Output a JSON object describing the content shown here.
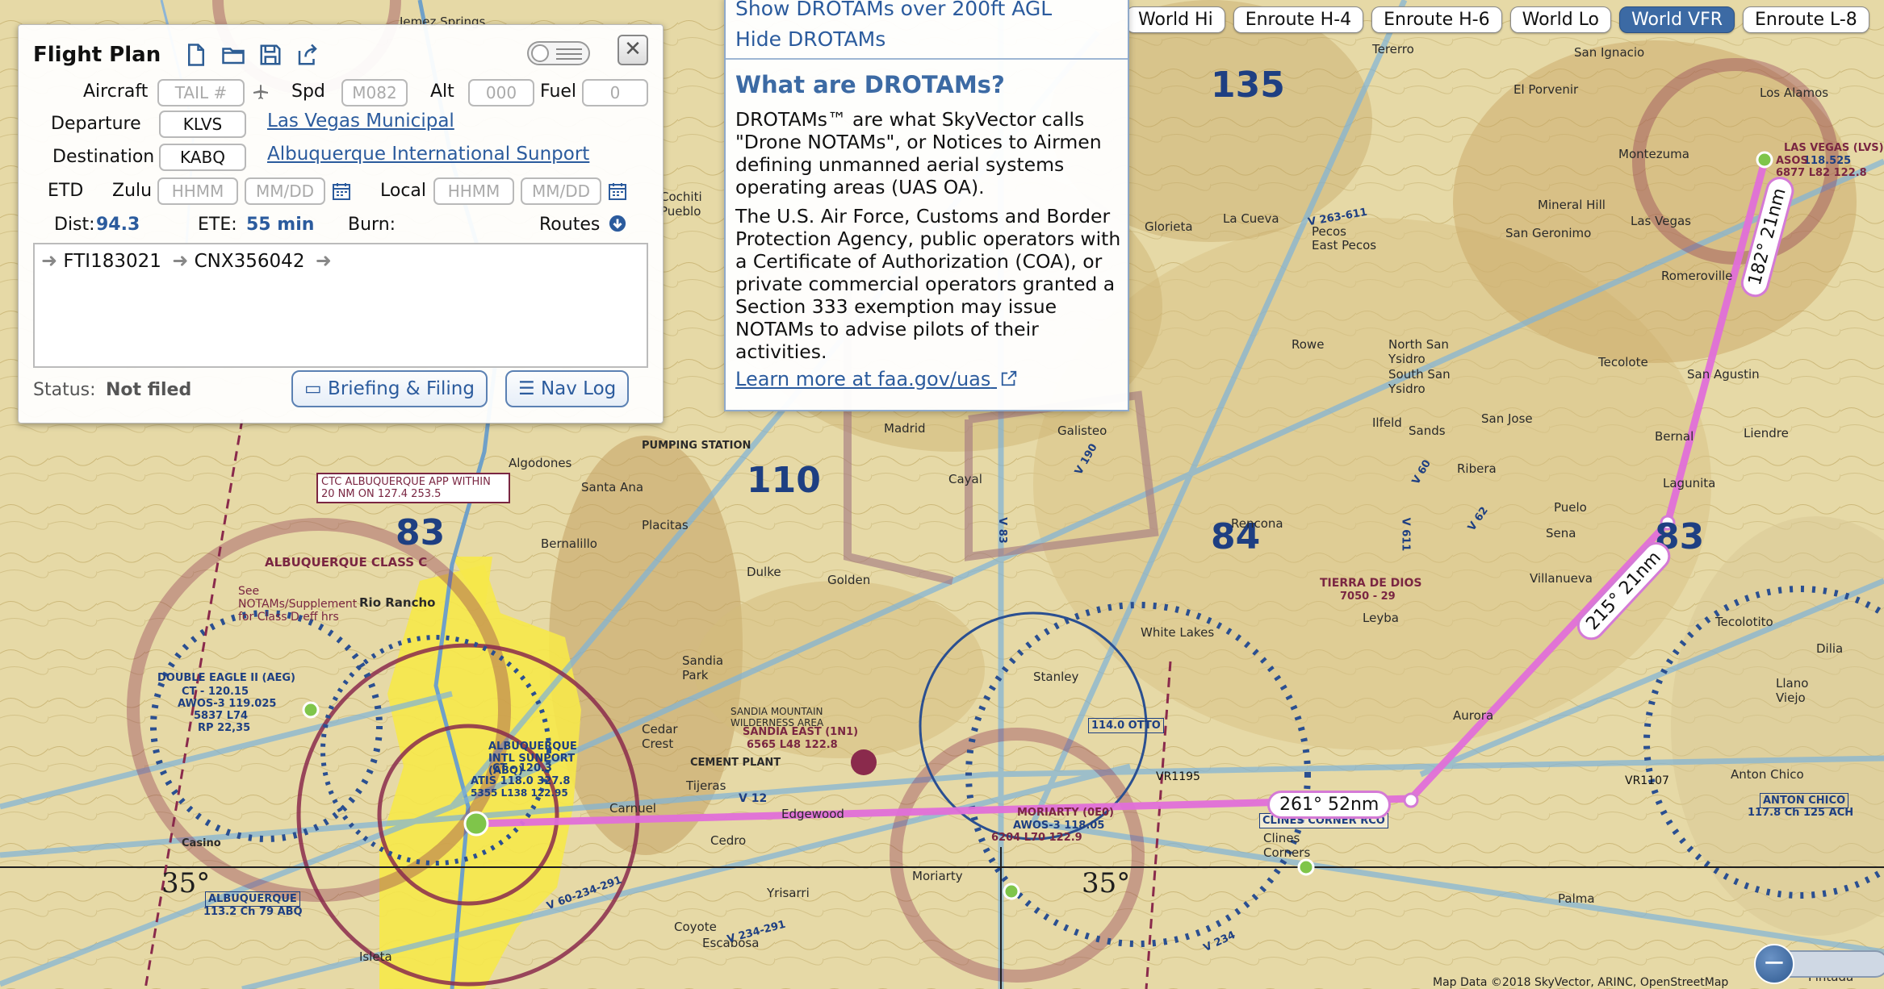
{
  "layer_tabs": [
    "World Hi",
    "Enroute H-4",
    "Enroute H-6",
    "World Lo",
    "World VFR",
    "Enroute L-8"
  ],
  "active_layer": "World VFR",
  "flight_plan": {
    "title": "Flight Plan",
    "aircraft_label": "Aircraft",
    "aircraft_placeholder": "TAIL #",
    "spd_label": "Spd",
    "spd_placeholder": "M082",
    "alt_label": "Alt",
    "alt_placeholder": "000",
    "fuel_label": "Fuel",
    "fuel_placeholder": "0",
    "departure_label": "Departure",
    "departure_code": "KLVS",
    "departure_name": "Las Vegas Municipal",
    "destination_label": "Destination",
    "destination_code": "KABQ",
    "destination_name": "Albuquerque International Sunport",
    "etd_label": "ETD",
    "zulu_label": "Zulu",
    "zulu_time_placeholder": "HHMM",
    "zulu_date_placeholder": "MM/DD",
    "local_label": "Local",
    "local_time_placeholder": "HHMM",
    "local_date_placeholder": "MM/DD",
    "dist_label": "Dist:",
    "dist_value": "94.3",
    "ete_label": "ETE:",
    "ete_value": "55 min",
    "burn_label": "Burn:",
    "routes_label": "Routes",
    "route": [
      "FTI183021",
      "CNX356042"
    ],
    "status_label": "Status:",
    "status_value": "Not filed",
    "briefing_button": "Briefing & Filing",
    "navlog_button": "Nav Log"
  },
  "drotam": {
    "show_link": "Show DROTAMs over 200ft AGL",
    "hide_link": "Hide DROTAMs",
    "heading": "What are DROTAMs?",
    "para1": "DROTAMs™ are what SkyVector calls \"Drone NOTAMs\", or Notices to Airmen defining unmanned aerial systems operating areas (UAS OA).",
    "para2": "The U.S. Air Force, Customs and Border Protection Agency, public operators with a Certificate of Authorization (COA), or private commercial operators granted a Section 333 exemption may issue NOTAMs to advise pilots of their activities.",
    "learn_more": "Learn more at faa.gov/uas"
  },
  "route_legs": [
    {
      "label": "182° 21nm"
    },
    {
      "label": "215° 21nm"
    },
    {
      "label": "261° 52nm"
    }
  ],
  "map_labels": {
    "towns": [
      "Jemez Springs",
      "Tererro",
      "San Ignacio",
      "El Porvenir",
      "Los Alamos",
      "Montezuma",
      "Las Vegas",
      "Romeroville",
      "Mineral Hill",
      "San Geronimo",
      "Glorieta",
      "La Cueva",
      "Pecos",
      "East Pecos",
      "Cochiti Pueblo",
      "Rowe",
      "North San Ysidro",
      "South San Ysidro",
      "Ilfeld",
      "Sands",
      "Tecolote",
      "San Agustin",
      "San Jose",
      "Ribera",
      "Bernal",
      "Lagunita",
      "Liendre",
      "Puelo",
      "Sena",
      "Villanueva",
      "Madrid",
      "Galisteo",
      "Cayal",
      "Placitas",
      "Algodones",
      "Santa Ana",
      "Bernalillo",
      "Golden",
      "Dulke",
      "Rencona",
      "Leyba",
      "White Lakes",
      "Stanley",
      "Cedar Crest",
      "Tijeras",
      "Edgewood",
      "Carnuel",
      "Cedro",
      "Moriarty",
      "Clines Corners",
      "Yrisarri",
      "Escabosa",
      "Coyote",
      "Palma",
      "Aurora",
      "Tecolotito",
      "Dilia",
      "Llano Viejo",
      "Anton Chico",
      "Isleta",
      "Casino",
      "Pintada",
      "Rio Rancho",
      "Sandia Park"
    ],
    "albuquerque_class_c": "ALBUQUERQUE CLASS C",
    "see_notams": "See NOTAMs/Supplement for Class D eff hrs",
    "ctc_albuquerque": "CTC ALBUQUERQUE APP WITHIN 20 NM ON 127.4 253.5",
    "albuquerque_intl": "ALBUQUERQUE INTL SUNPORT (ABQ)",
    "ct_abq": "CT - 120.3",
    "atis_abq": "ATIS 118.0 327.8",
    "abq_elev": "5355 L138 122.95",
    "double_eagle": "DOUBLE EAGLE II (AEG)",
    "double_eagle_freq": "CT - 120.15",
    "double_eagle_awos": "AWOS-3 119.025",
    "double_eagle_elev": "5837 L74",
    "double_eagle_rp": "RP 22,35",
    "sandia_east": "SANDIA EAST (1N1)",
    "sandia_east_info": "6565 L48 122.8",
    "moriarty": "MORIARTY (0E0)",
    "moriarty_awos": "AWOS-3 118.05",
    "moriarty_info": "6204 L70 122.9",
    "las_vegas": "LAS VEGAS (LVS)",
    "las_vegas_freq": "118.525",
    "las_vegas_asos": "ASOS",
    "las_vegas_info": "6877 L82 122.8",
    "clines_corner_rco": "CLINES CORNER RCO",
    "albuquerque_vor": "ALBUQUERQUE",
    "albuquerque_vor_info": "113.2 Ch 79 ABQ",
    "anton_chico_vor": "ANTON CHICO",
    "anton_chico_info": "117.8 Ch 125 ACH",
    "otto_vor": "114.0 OTTO",
    "tierra_de_dios": "TIERRA DE DIOS",
    "tierra_info": "7050 - 29",
    "pumping_station": "PUMPING STATION",
    "cement_plant": "CEMENT PLANT",
    "sandia_mountain": "SANDIA MOUNTAIN WILDERNESS AREA",
    "max_elev": [
      "135",
      "110",
      "84",
      "83",
      "83"
    ],
    "mag_degrees": [
      "35°",
      "35°"
    ],
    "airways": [
      "V 263-611",
      "V 60",
      "V 12",
      "V 62",
      "V 190",
      "V 611",
      "V 83",
      "V 234-291",
      "V 234",
      "VR1195",
      "VR1107",
      "V 60-234-291"
    ]
  },
  "copyright": "Map Data ©2018 SkyVector, ARINC, OpenStreetMap"
}
